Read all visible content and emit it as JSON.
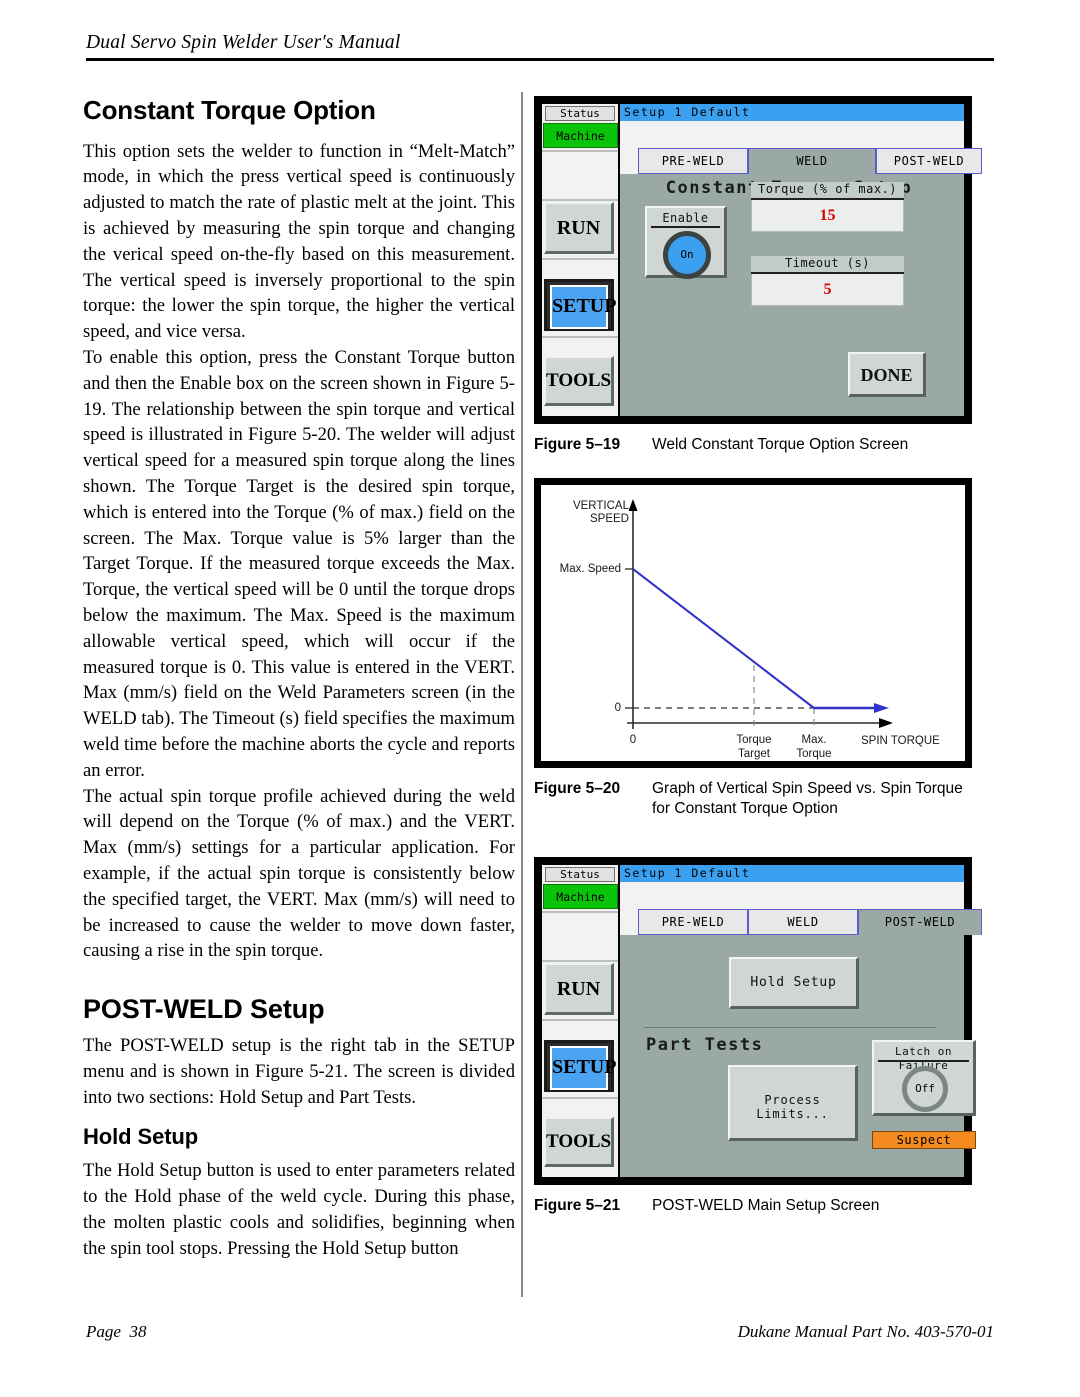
{
  "document": {
    "running_head": "Dual Servo Spin Welder User's Manual",
    "page_label": "Page",
    "page_number": "38",
    "manual_part": "Dukane Manual Part No. 403-570-01"
  },
  "left_column": {
    "heading_1": "Constant Torque Option",
    "para_1": "This option sets the welder to function in “Melt-Match” mode, in which the press vertical speed is continuously adjusted to match the rate of plastic melt at the joint. This is achieved by measuring the spin torque and changing the verical speed on-the-fly based on this measurement. The vertical speed is inversely proportional to the spin torque:  the lower the spin torque, the higher the vertical speed, and vice versa.",
    "para_2": "To enable this option, press the Constant Torque button and then the Enable box on the screen shown in Figure 5-19. The relationship between the spin torque and vertical speed is illustrated in Figure 5-20. The welder will adjust vertical speed for a measured spin torque along the lines shown. The Torque Target is the desired spin torque, which is entered into the Torque (% of max.) field on the screen. The Max. Torque value is 5% larger than the Target Torque. If the measured torque exceeds the Max. Torque, the vertical speed will be 0 until the torque drops below the maximum. The Max. Speed is the maximum allowable vertical speed, which will occur if the measured torque is 0. This value is entered in the VERT. Max (mm/s) field on the Weld Parameters screen (in the WELD tab). The Timeout (s) field specifies the maximum weld time before the machine aborts the cycle and reports an error.",
    "para_3": "The actual spin torque profile achieved during the weld will depend on the Torque (% of max.) and the VERT. Max (mm/s) settings for a particular application. For example, if the actual spin torque is consistently below the specified target, the VERT. Max (mm/s) will need to be increased to cause the welder to move down faster, causing a rise in the spin torque.",
    "heading_2": "POST-WELD Setup",
    "para_4": "The POST-WELD setup is the right tab in the SETUP menu and is shown in Figure 5-21. The screen is divided into two sections: Hold Setup and Part Tests.",
    "heading_3": "Hold Setup",
    "para_5": "The Hold Setup button is used to enter parameters related to the Hold phase of the weld cycle. During this phase, the molten plastic cools and solidifies, beginning when the spin tool stops. Pressing the Hold Setup button"
  },
  "figure_519": {
    "caption_number": "Figure 5–19",
    "caption_text": "Weld Constant Torque Option Screen",
    "screen": {
      "status_label": "Status",
      "machine_label": "Machine",
      "title_bar": "Setup 1   Default",
      "tabs": [
        {
          "label": "PRE-WELD",
          "active": false
        },
        {
          "label": "WELD",
          "active": true
        },
        {
          "label": "POST-WELD",
          "active": false
        }
      ],
      "panel_title": "Constant Torque Setup",
      "enable_label": "Enable",
      "enable_state": "On",
      "torque_field_label": "Torque (% of max.)",
      "torque_field_value": "15",
      "timeout_field_label": "Timeout (s)",
      "timeout_field_value": "5",
      "rail_buttons": [
        {
          "label": "RUN",
          "selected": false
        },
        {
          "label": "SETUP",
          "selected": true
        },
        {
          "label": "TOOLS",
          "selected": false
        }
      ],
      "done_label": "DONE"
    }
  },
  "figure_520": {
    "caption_number": "Figure 5–20",
    "caption_text": "Graph of Vertical Spin Speed vs. Spin Torque for Constant Torque Option",
    "labels": {
      "y_axis_line1": "VERTICAL",
      "y_axis_line2": "SPEED",
      "y_tick_max": "Max. Speed",
      "y_tick_zero": "0",
      "x_origin": "0",
      "x_tick_1_line1": "Torque",
      "x_tick_1_line2": "Target",
      "x_tick_2_line1": "Max.",
      "x_tick_2_line2": "Torque",
      "x_axis": "SPIN TORQUE"
    },
    "line_color": "#3333cc"
  },
  "chart_data": {
    "type": "line",
    "title": "Graph of Vertical Spin Speed vs. Spin Torque for Constant Torque Option",
    "xlabel": "SPIN TORQUE",
    "ylabel": "VERTICAL SPEED",
    "x_tick_labels": [
      "0",
      "Torque Target",
      "Max. Torque"
    ],
    "y_tick_labels": [
      "0",
      "Max. Speed"
    ],
    "series": [
      {
        "name": "Vertical Speed vs Spin Torque",
        "x": [
          0,
          "Torque Target",
          "Max. Torque",
          "beyond Max. Torque"
        ],
        "y": [
          "Max. Speed",
          "~0.42 Max. Speed",
          0,
          0
        ],
        "color": "#3333cc"
      }
    ],
    "annotations": [
      "Dashed vertical guide at Torque Target",
      "Dashed vertical guide at Max. Torque",
      "Dashed horizontal guide at y = 0",
      "Arrowhead at right end of flat zero segment"
    ],
    "grid": false,
    "legend": "none"
  },
  "figure_521": {
    "caption_number": "Figure 5–21",
    "caption_text": "POST-WELD Main Setup Screen",
    "screen": {
      "status_label": "Status",
      "machine_label": "Machine",
      "title_bar": "Setup 1   Default",
      "tabs": [
        {
          "label": "PRE-WELD",
          "active": false
        },
        {
          "label": "WELD",
          "active": false
        },
        {
          "label": "POST-WELD",
          "active": true
        }
      ],
      "hold_setup_button": "Hold Setup",
      "part_tests_title": "Part Tests",
      "process_limits_line1": "Process",
      "process_limits_line2": "Limits...",
      "latch_label": "Latch on Failure",
      "latch_state": "Off",
      "suspect_label": "Suspect",
      "rail_buttons": [
        {
          "label": "RUN",
          "selected": false
        },
        {
          "label": "SETUP",
          "selected": true
        },
        {
          "label": "TOOLS",
          "selected": false
        }
      ]
    }
  }
}
